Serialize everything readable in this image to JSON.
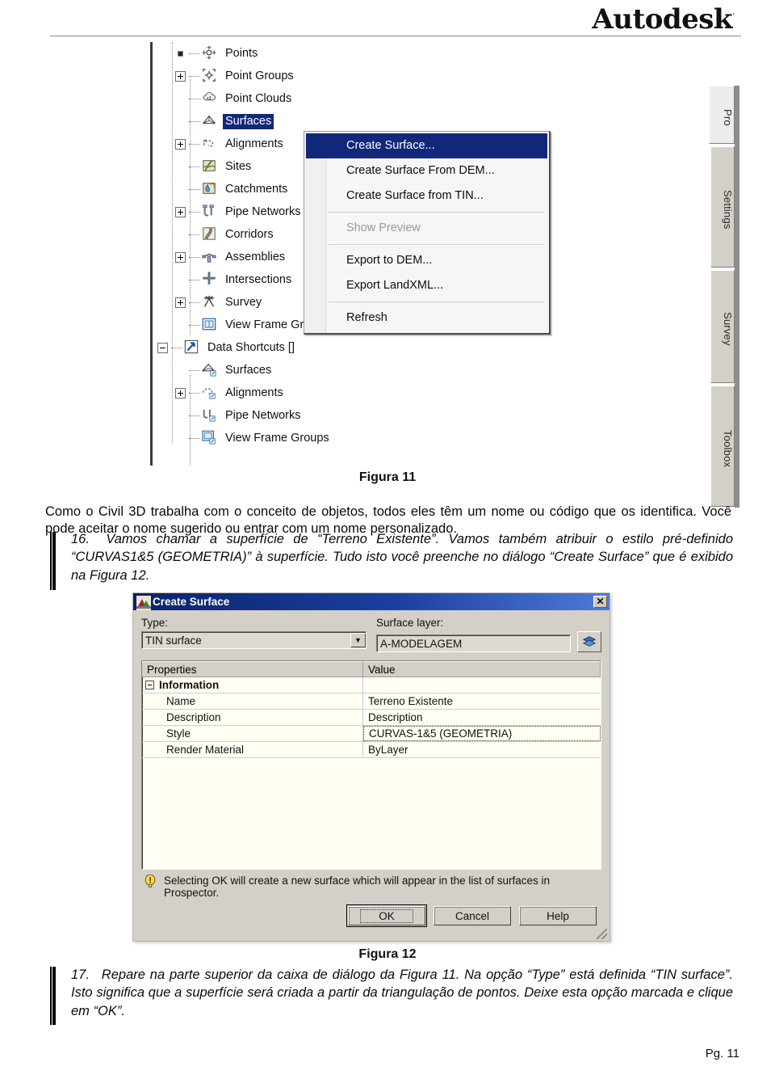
{
  "header": {
    "brand": "Autodesk",
    "registered_mark": "·"
  },
  "figure11": {
    "caption": "Figura 11",
    "tree": {
      "items": [
        {
          "label": "Points",
          "icon": "points-icon",
          "expander": "dot",
          "indent": 1
        },
        {
          "label": "Point Groups",
          "icon": "point-groups-icon",
          "expander": "plus",
          "indent": 1
        },
        {
          "label": "Point Clouds",
          "icon": "point-clouds-icon",
          "expander": "none",
          "indent": 1
        },
        {
          "label": "Surfaces",
          "icon": "surfaces-icon",
          "expander": "none",
          "indent": 1,
          "selected": true
        },
        {
          "label": "Alignments",
          "icon": "alignments-icon",
          "expander": "plus",
          "indent": 1
        },
        {
          "label": "Sites",
          "icon": "sites-icon",
          "expander": "none",
          "indent": 1
        },
        {
          "label": "Catchments",
          "icon": "catchments-icon",
          "expander": "none",
          "indent": 1
        },
        {
          "label": "Pipe Networks",
          "icon": "pipe-networks-icon",
          "expander": "plus",
          "indent": 1
        },
        {
          "label": "Corridors",
          "icon": "corridors-icon",
          "expander": "none",
          "indent": 1
        },
        {
          "label": "Assemblies",
          "icon": "assemblies-icon",
          "expander": "plus",
          "indent": 1
        },
        {
          "label": "Intersections",
          "icon": "intersections-icon",
          "expander": "none",
          "indent": 1
        },
        {
          "label": "Survey",
          "icon": "survey-icon",
          "expander": "plus",
          "indent": 1
        },
        {
          "label": "View Frame Groups",
          "icon": "view-frame-groups-icon",
          "expander": "none",
          "indent": 1
        },
        {
          "label": "Data Shortcuts []",
          "icon": "data-shortcuts-icon",
          "expander": "minus",
          "indent": 0
        },
        {
          "label": "Surfaces",
          "icon": "surfaces-shortcut-icon",
          "expander": "none",
          "indent": 1
        },
        {
          "label": "Alignments",
          "icon": "alignments-shortcut-icon",
          "expander": "plus",
          "indent": 1
        },
        {
          "label": "Pipe Networks",
          "icon": "pipe-networks-shortcut-icon",
          "expander": "none",
          "indent": 1
        },
        {
          "label": "View Frame Groups",
          "icon": "view-frame-groups-shortcut-icon",
          "expander": "none",
          "indent": 1
        }
      ]
    },
    "context_menu": {
      "items": [
        {
          "label": "Create Surface...",
          "state": "highlight"
        },
        {
          "label": "Create Surface From DEM...",
          "state": "normal"
        },
        {
          "label": "Create Surface from TIN...",
          "state": "normal"
        },
        {
          "separator": true
        },
        {
          "label": "Show Preview",
          "state": "disabled"
        },
        {
          "separator": true
        },
        {
          "label": "Export to DEM...",
          "state": "normal"
        },
        {
          "label": "Export LandXML...",
          "state": "normal"
        },
        {
          "separator": true
        },
        {
          "label": "Refresh",
          "state": "normal"
        }
      ]
    },
    "vertical_tabs": [
      {
        "label": "Pro",
        "active": true
      },
      {
        "label": "Settings",
        "active": false
      },
      {
        "label": "Survey",
        "active": false
      },
      {
        "label": "Toolbox",
        "active": false
      }
    ]
  },
  "paragraph_intro": "Como o Civil 3D trabalha com o conceito de objetos, todos eles têm um nome ou código que os identifica. Você pode aceitar o nome sugerido ou entrar com um nome personalizado.",
  "item_16": {
    "number": "16.",
    "text": "Vamos chamar a superfície de “Terreno Existente”. Vamos também atribuir o estilo pré-definido “CURVAS1&5 (GEOMETRIA)” à superfície. Tudo isto você preenche no diálogo “Create Surface” que é exibido na Figura 12."
  },
  "item_17": {
    "number": "17.",
    "text": "Repare na parte superior da caixa de diálogo da Figura 11. Na opção “Type” está definida “TIN surface”. Isto significa que a superfície será criada a partir da triangulação de pontos. Deixe esta opção marcada e clique em “OK”."
  },
  "figure12": {
    "caption": "Figura 12",
    "dialog": {
      "title": "Create Surface",
      "close_label": "✕",
      "type_label": "Type:",
      "type_value": "TIN surface",
      "surface_layer_label": "Surface layer:",
      "surface_layer_value": "A-MODELAGEM",
      "layer_button_icon": "layers-icon",
      "grid": {
        "columns": [
          "Properties",
          "Value"
        ],
        "rows": [
          {
            "kind": "group",
            "property": "Information",
            "value": ""
          },
          {
            "kind": "item",
            "property": "Name",
            "value": "Terreno Existente"
          },
          {
            "kind": "item",
            "property": "Description",
            "value": "Description"
          },
          {
            "kind": "item",
            "property": "Style",
            "value": "CURVAS-1&5 (GEOMETRIA)",
            "focused": true
          },
          {
            "kind": "item",
            "property": "Render Material",
            "value": "ByLayer"
          }
        ]
      },
      "hint_icon": "warning-bulb-icon",
      "hint_text": "Selecting OK will create a new surface which will appear in the list of surfaces in Prospector.",
      "buttons": [
        {
          "label": "OK",
          "default": true
        },
        {
          "label": "Cancel",
          "default": false
        },
        {
          "label": "Help",
          "default": false
        }
      ]
    }
  },
  "footer": {
    "page_label": "Pg. 11"
  },
  "colors": {
    "selection_navy": "#10277a",
    "dialog_chrome": "#d4d0c8",
    "grid_ivory": "#fffff4",
    "grid_gridline": "#c9cce8",
    "titlebar_blue": "#0a246a"
  }
}
